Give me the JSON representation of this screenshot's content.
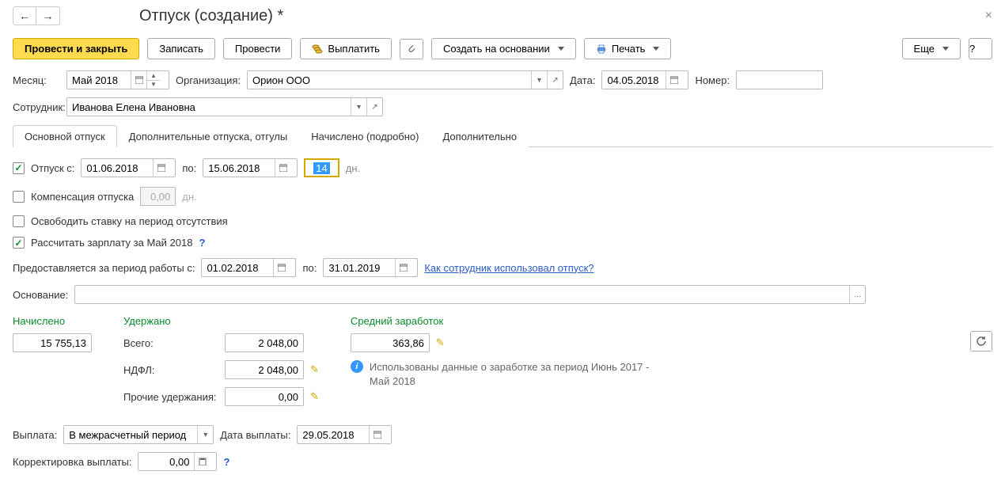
{
  "header": {
    "title": "Отпуск (создание) *"
  },
  "toolbar": {
    "postAndClose": "Провести и закрыть",
    "save": "Записать",
    "post": "Провести",
    "pay": "Выплатить",
    "createFrom": "Создать на основании",
    "print": "Печать",
    "more": "Еще",
    "help": "?"
  },
  "form": {
    "monthLabel": "Месяц:",
    "monthValue": "Май 2018",
    "orgLabel": "Организация:",
    "orgValue": "Орион ООО",
    "dateLabel": "Дата:",
    "dateValue": "04.05.2018",
    "numberLabel": "Номер:",
    "numberValue": "",
    "employeeLabel": "Сотрудник:",
    "employeeValue": "Иванова Елена Ивановна"
  },
  "tabs": {
    "main": "Основной отпуск",
    "extra": "Дополнительные отпуска, отгулы",
    "accrued": "Начислено (подробно)",
    "additional": "Дополнительно"
  },
  "main": {
    "vacationLabel": "Отпуск   с:",
    "from": "01.06.2018",
    "toLabel": "по:",
    "to": "15.06.2018",
    "days": "14",
    "daysLabel": "дн.",
    "compensationLabel": "Компенсация отпуска",
    "compensationValue": "0,00",
    "compensationDays": "дн.",
    "freePositionLabel": "Освободить ставку на период отсутствия",
    "calcSalaryLabel": "Рассчитать зарплату за Май 2018",
    "periodLabel": "Предоставляется за период работы с:",
    "periodFrom": "01.02.2018",
    "periodToLabel": "по:",
    "periodTo": "31.01.2019",
    "usageLink": "Как сотрудник использовал отпуск?",
    "basisLabel": "Основание:",
    "basisValue": ""
  },
  "calc": {
    "accruedLabel": "Начислено",
    "accruedValue": "15 755,13",
    "withheldLabel": "Удержано",
    "totalLabel": "Всего:",
    "totalValue": "2 048,00",
    "ndflLabel": "НДФЛ:",
    "ndflValue": "2 048,00",
    "otherLabel": "Прочие удержания:",
    "otherValue": "0,00",
    "avgLabel": "Средний заработок",
    "avgValue": "363,86",
    "infoText": "Использованы данные о заработке за период Июнь 2017 - Май 2018"
  },
  "payout": {
    "payoutLabel": "Выплата:",
    "payoutValue": "В межрасчетный период",
    "payoutDateLabel": "Дата выплаты:",
    "payoutDateValue": "29.05.2018",
    "correctionLabel": "Корректировка выплаты:",
    "correctionValue": "0,00"
  }
}
